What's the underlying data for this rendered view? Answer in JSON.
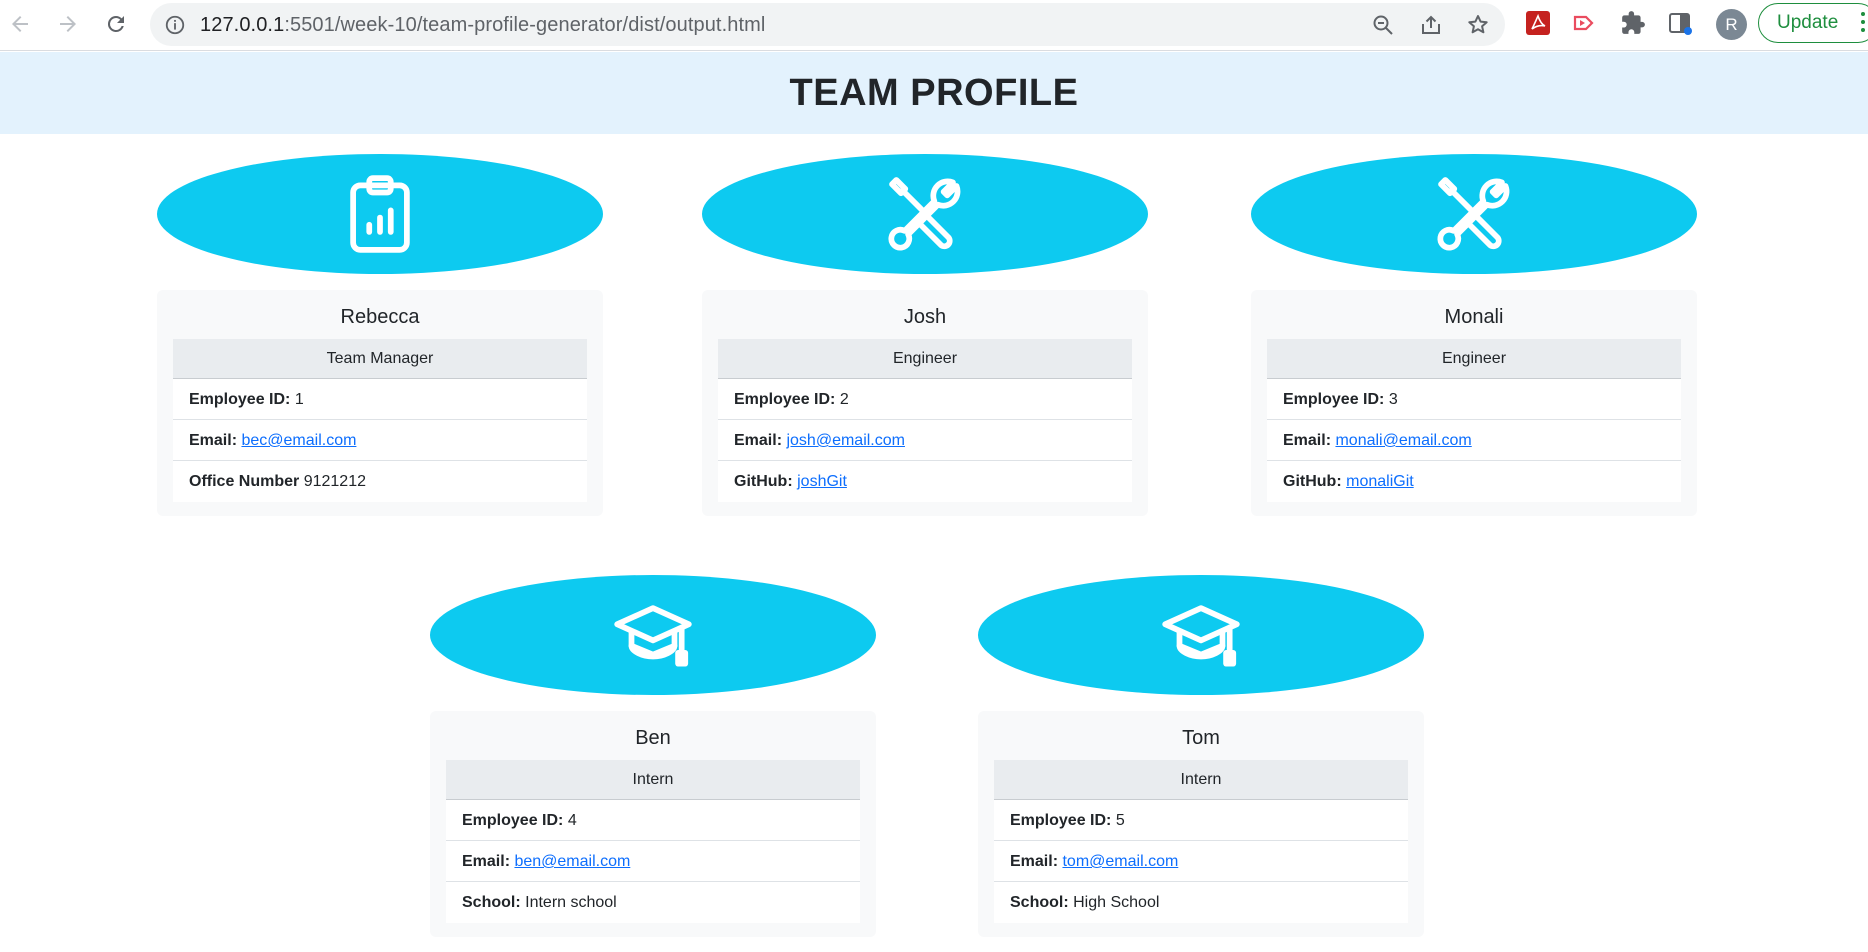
{
  "browser": {
    "url_host": "127.0.0.1",
    "url_rest": ":5501/week-10/team-profile-generator/dist/output.html",
    "avatar_letter": "R",
    "update_label": "Update"
  },
  "page": {
    "title": "TEAM PROFILE"
  },
  "employees": [
    {
      "name": "Rebecca",
      "role": "Team Manager",
      "icon": "clipboard-chart-icon",
      "id_label": "Employee ID:",
      "id": "1",
      "email_label": "Email:",
      "email": "bec@email.com",
      "extra_label": "Office Number",
      "extra_value": "9121212"
    },
    {
      "name": "Josh",
      "role": "Engineer",
      "icon": "tools-icon",
      "id_label": "Employee ID:",
      "id": "2",
      "email_label": "Email:",
      "email": "josh@email.com",
      "extra_label": "GitHub:",
      "extra_value": "joshGit"
    },
    {
      "name": "Monali",
      "role": "Engineer",
      "icon": "tools-icon",
      "id_label": "Employee ID:",
      "id": "3",
      "email_label": "Email:",
      "email": "monali@email.com",
      "extra_label": "GitHub:",
      "extra_value": "monaliGit"
    },
    {
      "name": "Ben",
      "role": "Intern",
      "icon": "graduation-cap-icon",
      "id_label": "Employee ID:",
      "id": "4",
      "email_label": "Email:",
      "email": "ben@email.com",
      "extra_label": "School:",
      "extra_value": "Intern school"
    },
    {
      "name": "Tom",
      "role": "Intern",
      "icon": "graduation-cap-icon",
      "id_label": "Employee ID:",
      "id": "5",
      "email_label": "Email:",
      "email": "tom@email.com",
      "extra_label": "School:",
      "extra_value": "High School"
    }
  ],
  "colors": {
    "header_bg": "#e3f2fd",
    "bubble": "#0dcaf0",
    "link": "#0d6efd"
  }
}
